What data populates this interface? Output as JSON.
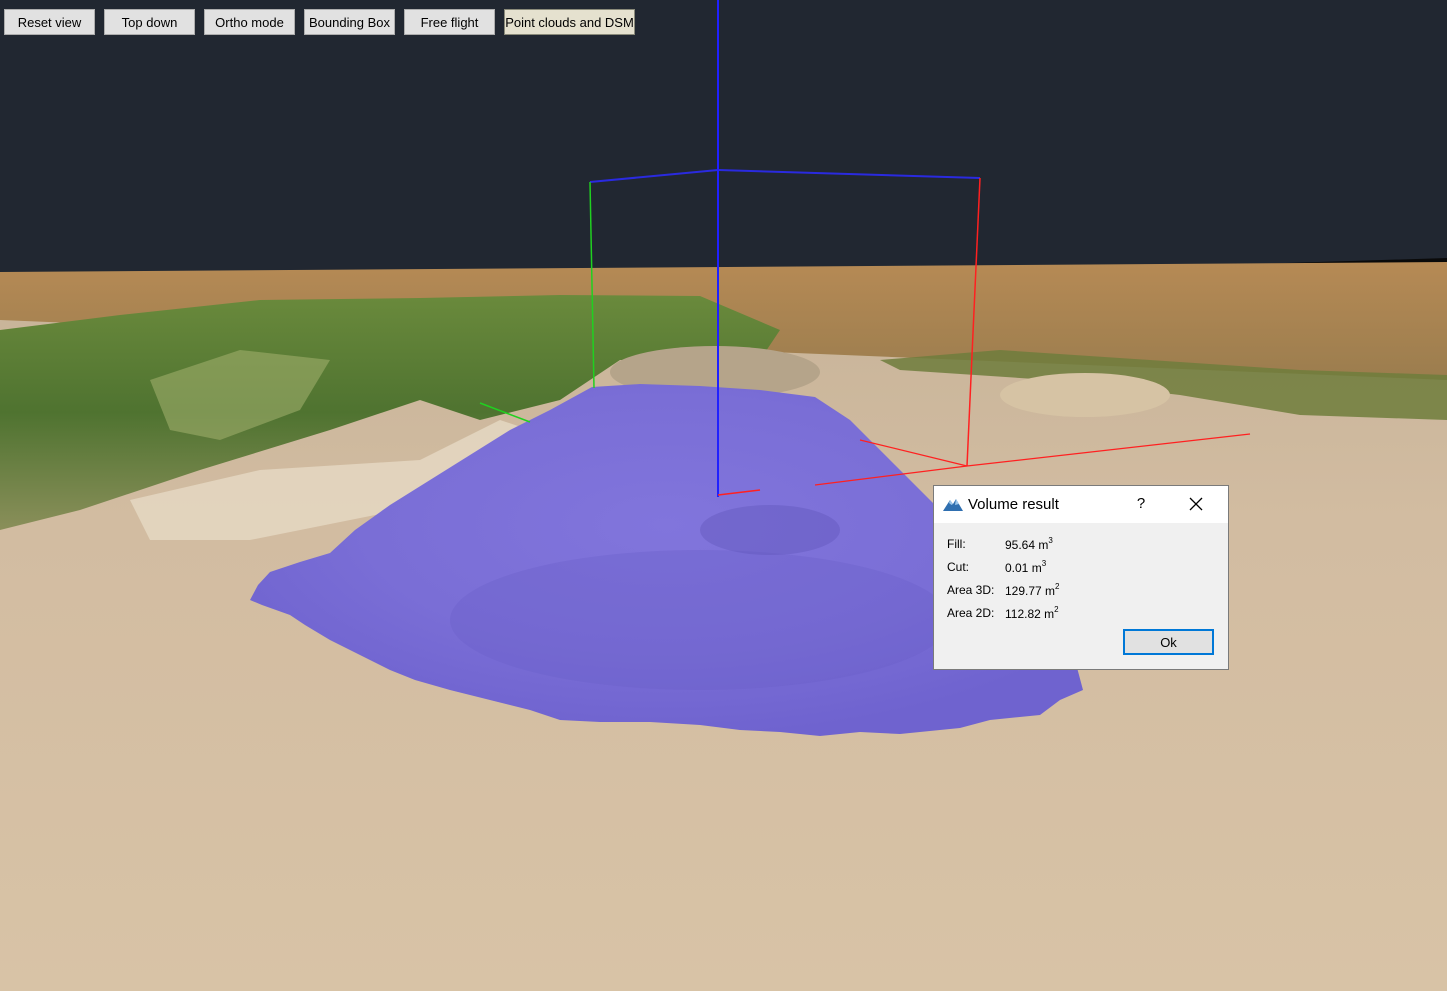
{
  "toolbar": {
    "buttons": [
      {
        "label": "Reset view"
      },
      {
        "label": "Top down"
      },
      {
        "label": "Ortho mode"
      },
      {
        "label": "Bounding Box"
      },
      {
        "label": "Free flight"
      },
      {
        "label": "Point clouds and DSM",
        "active": true
      }
    ]
  },
  "dialog": {
    "title": "Volume result",
    "help_label": "?",
    "app_icon": "mountain-logo-icon",
    "close_icon": "close-icon",
    "rows": [
      {
        "label": "Fill:",
        "value": "95.64 m",
        "unit_exp": "3"
      },
      {
        "label": "Cut:",
        "value": "0.01 m",
        "unit_exp": "3"
      },
      {
        "label": "Area 3D:",
        "value": "129.77 m",
        "unit_exp": "2"
      },
      {
        "label": "Area 2D:",
        "value": "112.82 m",
        "unit_exp": "2"
      }
    ],
    "ok_label": "Ok"
  },
  "colors": {
    "sky": "#212731",
    "volume_overlay": "#7b6fd8",
    "axis_x": "#ff2020",
    "axis_y": "#20d020",
    "axis_z": "#2020ff",
    "ok_focus": "#0078d7"
  }
}
